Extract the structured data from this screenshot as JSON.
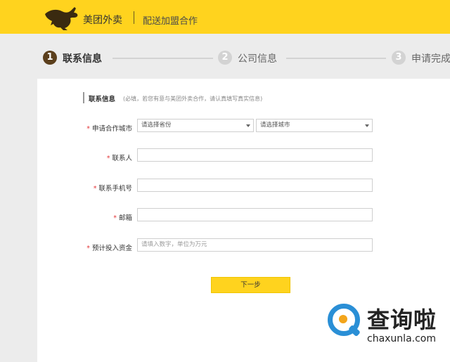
{
  "header": {
    "brand": "美团外卖",
    "subtitle": "配送加盟合作",
    "logo_icon": "kangaroo-logo-icon",
    "bg_color": "#ffd31e"
  },
  "steps": [
    {
      "num": "1",
      "label": "联系信息",
      "state": "active"
    },
    {
      "num": "2",
      "label": "公司信息",
      "state": "inactive"
    },
    {
      "num": "3",
      "label": "申请完成",
      "state": "inactive"
    }
  ],
  "form": {
    "section_title": "联系信息",
    "section_hint": "(必填，若您有意与美团外卖合作，请认真填写真实信息)",
    "required_mark": "*",
    "city_label": "申请合作城市",
    "province_select": "请选择省份",
    "city_select": "请选择城市",
    "contact_label": "联系人",
    "contact_value": "",
    "phone_label": "联系手机号",
    "phone_value": "",
    "email_label": "邮箱",
    "email_value": "",
    "fund_label": "预计投入资金",
    "fund_placeholder": "请填入数字，单位为万元",
    "next_button": "下一步"
  },
  "watermark": {
    "cn": "查询啦",
    "en": "chaxunla.com"
  }
}
